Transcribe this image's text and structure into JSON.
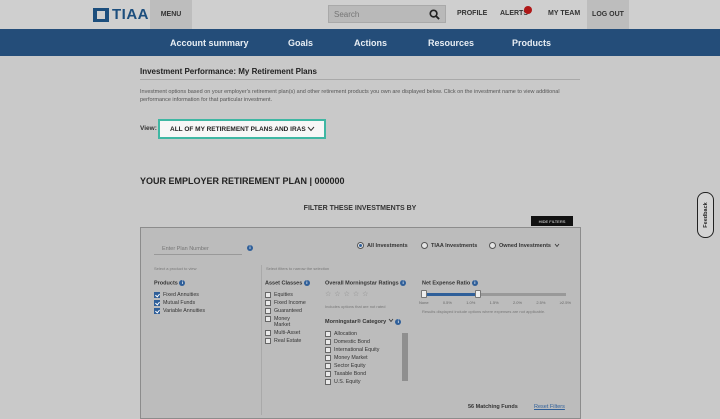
{
  "header": {
    "logo_text": "TIAA",
    "menu_label": "MENU",
    "search_placeholder": "Search",
    "profile_label": "PROFILE",
    "alerts_label": "ALERTS",
    "myteam_label": "MY TEAM",
    "logout_label": "LOG OUT"
  },
  "nav": {
    "items": [
      {
        "label": "Account summary"
      },
      {
        "label": "Goals"
      },
      {
        "label": "Actions"
      },
      {
        "label": "Resources"
      },
      {
        "label": "Products"
      }
    ]
  },
  "content": {
    "page_title": "Investment Performance: My Retirement Plans",
    "intro": "Investment options based on your employer's retirement plan(s) and other retirement products you own are displayed below. Click on the investment name to view additional performance information for that particular investment.",
    "view_label": "View:",
    "view_selected": "ALL OF MY RETIREMENT PLANS AND IRAS",
    "plan_heading": "YOUR EMPLOYER RETIREMENT PLAN | 000000",
    "filter_heading": "FILTER THESE INVESTMENTS BY",
    "hide_filters_label": "HIDE FILTERS"
  },
  "filters": {
    "plan_number_placeholder": "Enter Plan Number",
    "plan_hint": "Select a product to view",
    "radios": [
      {
        "label": "All Investments",
        "selected": true
      },
      {
        "label": "TIAA Investments",
        "selected": false
      },
      {
        "label": "Owned Investments",
        "selected": false
      }
    ],
    "filters_hint": "Select filters to narrow the selection",
    "products": {
      "title": "Products",
      "items": [
        {
          "label": "Fixed Annuities",
          "checked": true
        },
        {
          "label": "Mutual Funds",
          "checked": true
        },
        {
          "label": "Variable Annuities",
          "checked": true
        }
      ]
    },
    "asset_classes": {
      "title": "Asset Classes",
      "items": [
        {
          "label": "Equities",
          "checked": false
        },
        {
          "label": "Fixed Income",
          "checked": false
        },
        {
          "label": "Guaranteed",
          "checked": false
        },
        {
          "label": "Money Market",
          "checked": false
        },
        {
          "label": "Multi-Asset",
          "checked": false
        },
        {
          "label": "Real Estate",
          "checked": false
        }
      ]
    },
    "ratings": {
      "title": "Overall Morningstar Ratings",
      "hint": "Includes options that are not rated",
      "stars": 5
    },
    "category": {
      "title": "Morningstar® Category",
      "items": [
        {
          "label": "Allocation",
          "checked": false
        },
        {
          "label": "Domestic Bond",
          "checked": false
        },
        {
          "label": "International Equity",
          "checked": false
        },
        {
          "label": "Money Market",
          "checked": false
        },
        {
          "label": "Sector Equity",
          "checked": false
        },
        {
          "label": "Taxable Bond",
          "checked": false
        },
        {
          "label": "U.S. Equity",
          "checked": false
        }
      ]
    },
    "expense": {
      "title": "Net Expense Ratio",
      "ticks": [
        "None",
        "0.5%",
        "1.0%",
        "1.5%",
        "2.0%",
        "2.5%",
        "≥2.5%"
      ],
      "range_low_fraction": 0.0,
      "range_high_fraction": 0.38,
      "hint": "Results displayed include options where expenses are not applicable."
    },
    "matching_label": "56 Matching Funds",
    "reset_label": "Reset Filters"
  },
  "feedback_label": "Feedback",
  "colors": {
    "brand_blue": "#244d79",
    "accent_teal": "#3fb7a3",
    "alert_red": "#b01818"
  }
}
